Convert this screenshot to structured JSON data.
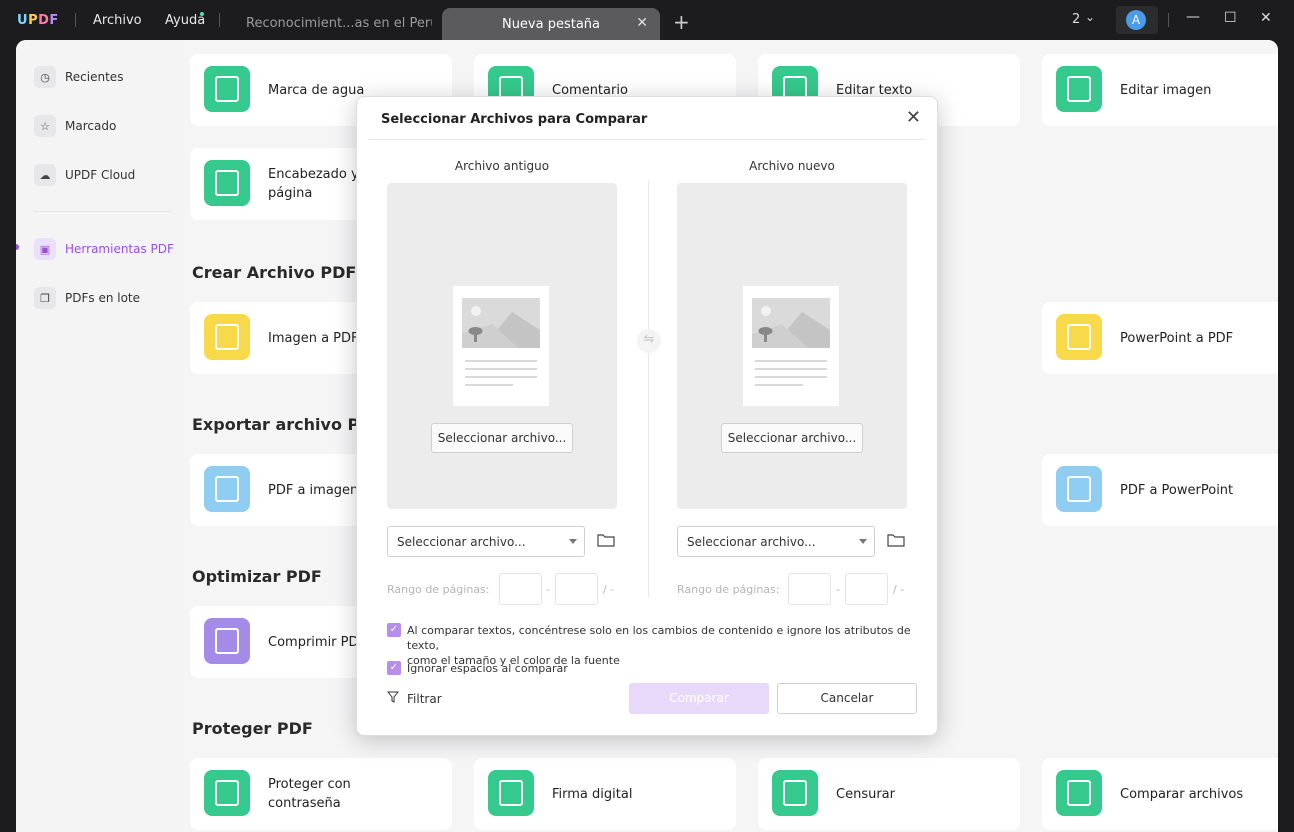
{
  "titlebar": {
    "logo": [
      "U",
      "P",
      "D",
      "F"
    ],
    "menu_file": "Archivo",
    "menu_help": "Ayuda",
    "tab_inactive": "Reconocimient...as en el Perú",
    "tab_active": "Nueva pestaña",
    "window_count": "2",
    "avatar_letter": "A"
  },
  "sidebar": {
    "items": [
      {
        "label": "Recientes",
        "icon": "clock-icon"
      },
      {
        "label": "Marcado",
        "icon": "star-icon"
      },
      {
        "label": "UPDF Cloud",
        "icon": "cloud-icon"
      },
      {
        "label": "Herramientas PDF",
        "icon": "toolbox-icon",
        "active": true
      },
      {
        "label": "PDFs en lote",
        "icon": "batch-icon"
      }
    ]
  },
  "sections": {
    "create": "Crear Archivo PDF",
    "export": "Exportar archivo PDF",
    "optimize": "Optimizar PDF",
    "protect": "Proteger PDF"
  },
  "cards": {
    "watermark": "Marca de agua",
    "comment": "Comentario",
    "edit_text": "Editar texto",
    "edit_image": "Editar imagen",
    "header_footer": "Encabezado y pie de\npágina",
    "image_to_pdf": "Imagen a PDF",
    "ppt_to_pdf": "PowerPoint a PDF",
    "pdf_to_image": "PDF a imagen",
    "pdf_to_ppt": "PDF a PowerPoint",
    "compress": "Comprimir PDF",
    "protect_password": "Proteger con\ncontraseña",
    "digital_signature": "Firma digital",
    "redact": "Censurar",
    "compare_files": "Comparar archivos"
  },
  "colors": {
    "accent": "#9a4fe0",
    "green_icon": "#35c98d",
    "yellow_icon": "#f8d94a",
    "blue_icon": "#8fcdf2",
    "purple_icon": "#a58be8",
    "compare_disabled": "#e8d9fb"
  },
  "dialog": {
    "title": "Seleccionar Archivos para Comparar",
    "old_file_title": "Archivo antiguo",
    "new_file_title": "Archivo nuevo",
    "select_file_button": "Seleccionar archivo...",
    "select_placeholder": "Seleccionar archivo...",
    "page_range_label": "Rango de páginas:",
    "range_dash": "-",
    "range_slash": "/ -",
    "option1_line1": "Al comparar textos, concéntrese solo en los cambios de contenido e ignore los atributos de texto,",
    "option1_line2": "como el tamaño y el color de la fuente",
    "option1_checked": true,
    "option2": "Ignorar espacios al comparar",
    "option2_checked": true,
    "filter": "Filtrar",
    "compare_button": "Comparar",
    "cancel_button": "Cancelar"
  }
}
